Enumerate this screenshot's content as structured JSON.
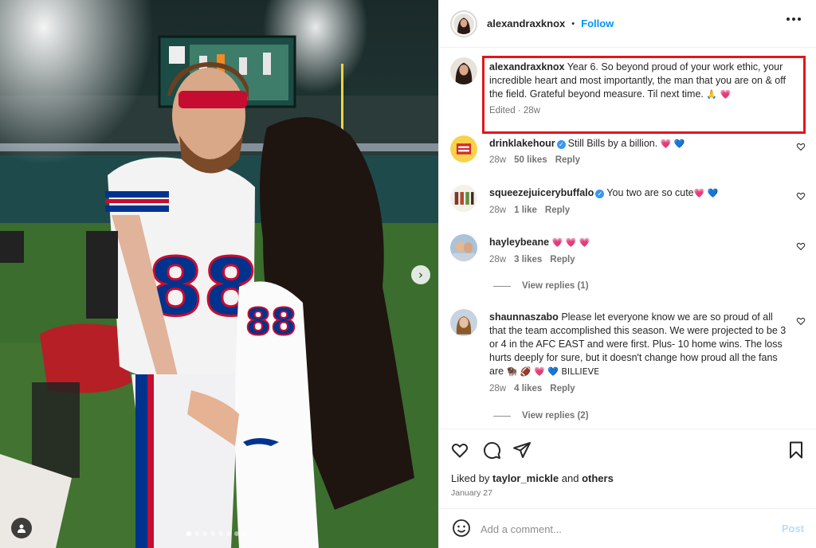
{
  "post": {
    "author": "alexandraxknox",
    "separator": "•",
    "follow_label": "Follow",
    "caption_author": "alexandraxknox",
    "caption_text": " Year 6. So beyond proud of your work ethic, your incredible heart and most importantly, the man that you are on & off the field. Grateful beyond measure. Til next time.",
    "caption_emoji": " 🙏 💗",
    "caption_meta": "Edited · 28w"
  },
  "photo": {
    "player_number": "88",
    "carousel_dots": 8,
    "active_dot": 0,
    "icons": [
      "chevron-right-icon",
      "user-tag-icon"
    ]
  },
  "comments": [
    {
      "username": "drinklakehour",
      "verified": true,
      "text": "Still Bills by a billion.",
      "emoji": " 💗 💙",
      "age": "28w",
      "likes": "50 likes",
      "reply": "Reply",
      "view_replies": ""
    },
    {
      "username": "squeezejuiceryb uffalo",
      "username_display": "squeezejuiceryb​uffalo",
      "verified": true,
      "text": "You two are so cute",
      "emoji": "💗 💙",
      "age": "28w",
      "likes": "1 like",
      "reply": "Reply",
      "view_replies": ""
    },
    {
      "username": "hayleybeane",
      "verified": false,
      "text": "",
      "emoji": "💗 💗 💗",
      "age": "28w",
      "likes": "3 likes",
      "reply": "Reply",
      "view_replies": "View replies (1)"
    },
    {
      "username": "shaunnaszabo",
      "verified": false,
      "text": "Please let everyone know we are so proud of all that the team accomplished this season. We were projected to be 3 or 4 in the AFC EAST and were first. Plus- 10 home wins. The loss hurts deeply for sure, but it doesn't change how proud all the fans are",
      "emoji": " 🦬 🏈 💗 💙 BILLIEVE",
      "age": "28w",
      "likes": "4 likes",
      "reply": "Reply",
      "view_replies": "View replies (2)"
    }
  ],
  "footer": {
    "liked_by_prefix": "Liked by ",
    "liked_by_user": "taylor_mickle",
    "liked_by_and": " and ",
    "liked_by_others": "others",
    "date": "January 27",
    "comment_placeholder": "Add a comment...",
    "post_label": "Post"
  },
  "colors": {
    "accent_blue": "#0095f6",
    "highlight_red": "#e1161c",
    "bills_blue": "#00338d",
    "bills_red": "#c60c30"
  }
}
